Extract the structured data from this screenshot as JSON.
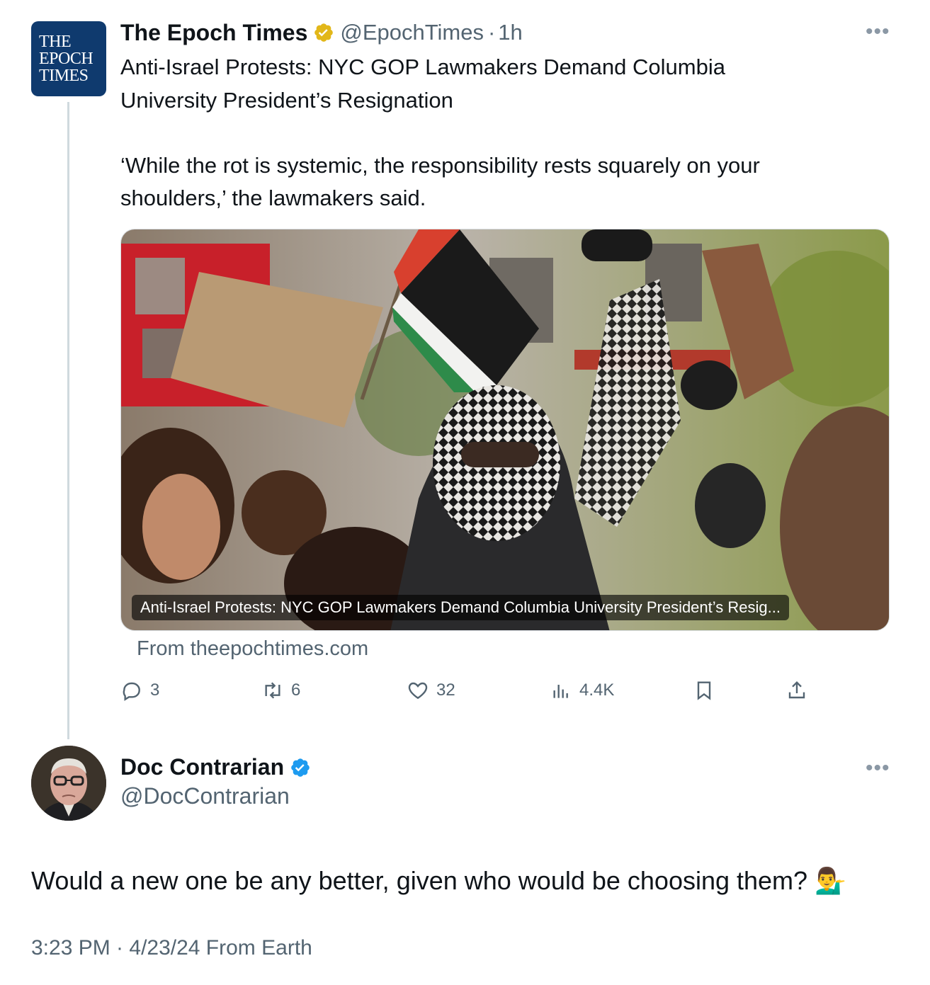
{
  "parent_tweet": {
    "logo_text": [
      "THE",
      "EPOCH",
      "TIMES"
    ],
    "display_name": "The Epoch Times",
    "verified_badge": "gold-verified-check",
    "handle": "@EpochTimes",
    "separator": "·",
    "time_ago": "1h",
    "more_icon": "more-options-icon",
    "title_line1": "Anti-Israel Protests: NYC GOP Lawmakers Demand Columbia",
    "title_line2": "University President’s Resignation",
    "quote_line1": "‘While the rot is systemic, the responsibility rests squarely on your",
    "quote_line2": "shoulders,’ the lawmakers said.",
    "media_caption": "Anti-Israel Protests: NYC GOP Lawmakers Demand Columbia University President’s Resig...",
    "source": "From theepochtimes.com",
    "actions": {
      "replies": "3",
      "reposts": "6",
      "likes": "32",
      "views": "4.4K"
    }
  },
  "reply_tweet": {
    "display_name": "Doc Contrarian",
    "verified_badge": "blue-verified-check",
    "handle": "@DocContrarian",
    "text": "Would a new one be any better, given who would be choosing them? 💁‍♂️",
    "timestamp": "3:23 PM · 4/23/24 From Earth"
  },
  "colors": {
    "text": "#0f1419",
    "secondary": "#536471",
    "thread_line": "#cfd9de",
    "gold_badge": "#e2b719",
    "blue_badge": "#1d9bf0",
    "epoch_blue": "#0f3a6e"
  }
}
